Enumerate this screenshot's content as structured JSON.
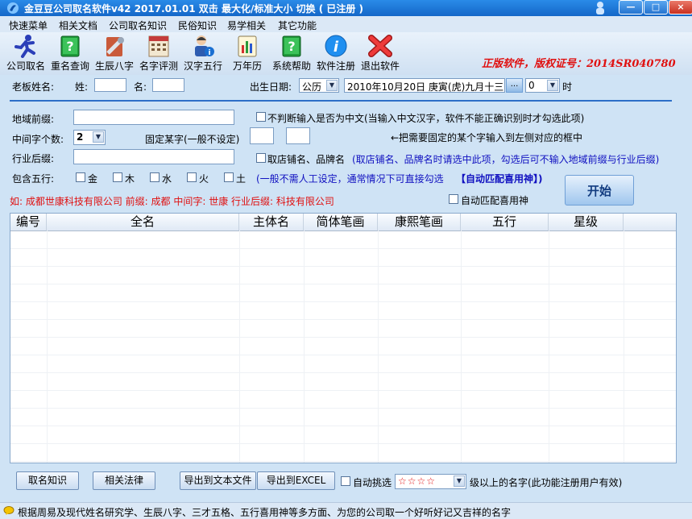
{
  "window": {
    "title": "金豆豆公司取名软件v42   2017.01.01  双击 最大化/标准大小 切换 ( 已注册 )",
    "buttons": {
      "min": "—",
      "max": "□",
      "close": "×"
    }
  },
  "menu": [
    "快速菜单",
    "相关文档",
    "公司取名知识",
    "民俗知识",
    "易学相关",
    "其它功能"
  ],
  "toolbar": {
    "items": [
      {
        "label": "公司取名",
        "icon": "runner-icon"
      },
      {
        "label": "重名查询",
        "icon": "green-book-icon"
      },
      {
        "label": "生辰八字",
        "icon": "tools-icon"
      },
      {
        "label": "名字评测",
        "icon": "calendar-icon"
      },
      {
        "label": "汉字五行",
        "icon": "person-info-icon"
      },
      {
        "label": "万年历",
        "icon": "chart-icon"
      },
      {
        "label": "系统帮助",
        "icon": "green-help-book-icon"
      },
      {
        "label": "软件注册",
        "icon": "info-icon"
      },
      {
        "label": "退出软件",
        "icon": "red-x-icon"
      }
    ],
    "license_text": "正版软件，版权证号：2014SR040780"
  },
  "form": {
    "boss_name_label": "老板姓名:",
    "surname_label": "姓:",
    "given_label": "名:",
    "surname_value": "",
    "given_value": "",
    "birth_label": "出生日期:",
    "calendar_type": "公历",
    "birth_date": "2010年10月20日 庚寅(虎)九月十三",
    "date_picker_btn": "...",
    "hour_value": "0",
    "hour_unit": "时",
    "region_prefix_label": "地域前缀:",
    "region_prefix_value": "",
    "no_chinese_check_label": "不判断输入是否为中文(当输入中文汉字，软件不能正确识别时才勾选此项)",
    "middle_count_label": "中间字个数:",
    "middle_count_value": "2",
    "fixed_char_label": "固定某字(一般不设定)",
    "fixed_char_1": "",
    "fixed_char_2": "",
    "fixed_hint": "←把需要固定的某个字输入到左侧对应的框中",
    "industry_suffix_label": "行业后缀:",
    "industry_suffix_value": "",
    "shop_name_label": "取店铺名、品牌名",
    "shop_name_hint": "(取店铺名、品牌名时请选中此项，勾选后可不输入地域前缀与行业后缀)",
    "wuxing_label": "包含五行:",
    "wuxing": [
      "金",
      "木",
      "水",
      "火",
      "土"
    ],
    "wuxing_hint": "(一般不需人工设定，通常情况下可直接勾选",
    "wuxing_hint2": "【自动匹配喜用神】)",
    "example_text": "如: 成都世康科技有限公司   前缀: 成都   中间字: 世康   行业后缀: 科技有限公司",
    "auto_match_label": "自动匹配喜用神",
    "start_label": "开始"
  },
  "table": {
    "headers": [
      "编号",
      "全名",
      "主体名",
      "简体笔画",
      "康熙笔画",
      "五行",
      "星级"
    ],
    "rows": []
  },
  "bottom": {
    "btn_knowledge": "取名知识",
    "btn_law": "相关法律",
    "btn_export_txt": "导出到文本文件",
    "btn_export_excel": "导出到EXCEL",
    "auto_pick_label": "自动挑选",
    "star_value": "☆☆☆☆",
    "star_hint": "级以上的名字(此功能注册用户有效)"
  },
  "status_text": "根据周易及现代姓名研究学、生辰八字、三才五格、五行喜用神等多方面、为您的公司取一个好听好记又吉祥的名字",
  "colors": {
    "titlebar": "#1a73d6",
    "accent_red": "#e01010",
    "accent_blue": "#1010c0",
    "bg": "#cfe3f5"
  }
}
